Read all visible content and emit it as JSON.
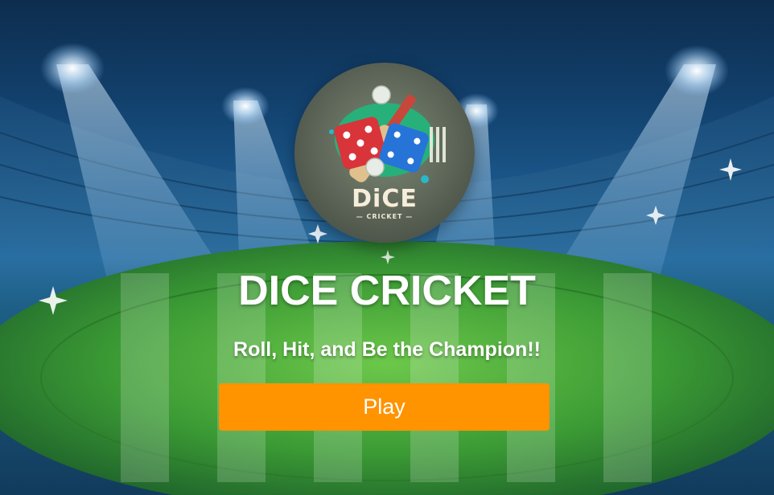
{
  "logo": {
    "word": "DiCE",
    "sub": "— CRICKET —"
  },
  "title": "DICE CRICKET",
  "subtitle": "Roll, Hit, and Be the Champion!!",
  "play_button": {
    "label": "Play"
  },
  "colors": {
    "button": "#ff9300",
    "text": "#ffffff",
    "field": "#3f9f36",
    "sky": "#12406c"
  }
}
